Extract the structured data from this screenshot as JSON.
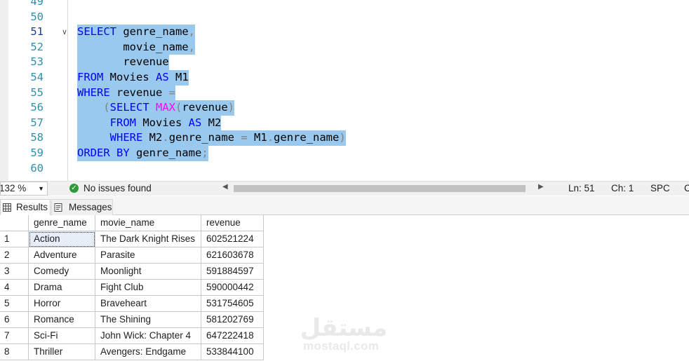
{
  "editor": {
    "lines": [
      {
        "num": "49",
        "tokens": []
      },
      {
        "num": "50",
        "tokens": []
      },
      {
        "num": "51",
        "fold": "∨",
        "tokens": [
          {
            "t": "SELECT",
            "c": "kw"
          },
          {
            "t": " genre_name"
          },
          {
            "t": ",",
            "c": "gray"
          }
        ]
      },
      {
        "num": "52",
        "tokens": [
          {
            "t": "       movie_name"
          },
          {
            "t": ",",
            "c": "gray"
          }
        ]
      },
      {
        "num": "53",
        "tokens": [
          {
            "t": "       revenue"
          }
        ]
      },
      {
        "num": "54",
        "tokens": [
          {
            "t": "FROM",
            "c": "kw"
          },
          {
            "t": " Movies "
          },
          {
            "t": "AS",
            "c": "kw"
          },
          {
            "t": " M1"
          }
        ]
      },
      {
        "num": "55",
        "tokens": [
          {
            "t": "WHERE",
            "c": "kw"
          },
          {
            "t": " revenue "
          },
          {
            "t": "=",
            "c": "gray"
          }
        ]
      },
      {
        "num": "56",
        "tokens": [
          {
            "t": "    "
          },
          {
            "t": "(",
            "c": "gray"
          },
          {
            "t": "SELECT",
            "c": "kw"
          },
          {
            "t": " "
          },
          {
            "t": "MAX",
            "c": "fn"
          },
          {
            "t": "(",
            "c": "gray"
          },
          {
            "t": "revenue"
          },
          {
            "t": ")",
            "c": "gray"
          }
        ]
      },
      {
        "num": "57",
        "tokens": [
          {
            "t": "     "
          },
          {
            "t": "FROM",
            "c": "kw"
          },
          {
            "t": " Movies "
          },
          {
            "t": "AS",
            "c": "kw"
          },
          {
            "t": " M2"
          }
        ]
      },
      {
        "num": "58",
        "tokens": [
          {
            "t": "     "
          },
          {
            "t": "WHERE",
            "c": "kw"
          },
          {
            "t": " M2"
          },
          {
            "t": ".",
            "c": "gray"
          },
          {
            "t": "genre_name "
          },
          {
            "t": "=",
            "c": "gray"
          },
          {
            "t": " M1"
          },
          {
            "t": ".",
            "c": "gray"
          },
          {
            "t": "genre_name"
          },
          {
            "t": ")",
            "c": "gray"
          }
        ]
      },
      {
        "num": "59",
        "tokens": [
          {
            "t": "ORDER BY",
            "c": "kw"
          },
          {
            "t": " genre_name"
          },
          {
            "t": ";",
            "c": "gray"
          }
        ]
      },
      {
        "num": "60",
        "tokens": []
      }
    ],
    "current_line": "51",
    "selected_lines": [
      "51",
      "52",
      "53",
      "54",
      "55",
      "56",
      "57",
      "58",
      "59"
    ]
  },
  "status": {
    "zoom": "132 %",
    "issues": "No issues found",
    "ln": "Ln: 51",
    "ch": "Ch: 1",
    "mode": "SPC",
    "extra": "C"
  },
  "tabs": {
    "results": "Results",
    "messages": "Messages"
  },
  "grid": {
    "headers": [
      "genre_name",
      "movie_name",
      "revenue"
    ],
    "rows": [
      [
        "1",
        "Action",
        "The Dark Knight Rises",
        "602521224"
      ],
      [
        "2",
        "Adventure",
        "Parasite",
        "621603678"
      ],
      [
        "3",
        "Comedy",
        "Moonlight",
        "591884597"
      ],
      [
        "4",
        "Drama",
        "Fight Club",
        "590000442"
      ],
      [
        "5",
        "Horror",
        "Braveheart",
        "531754605"
      ],
      [
        "6",
        "Romance",
        "The Shining",
        "581202769"
      ],
      [
        "7",
        "Sci-Fi",
        "John Wick: Chapter 4",
        "647222418"
      ],
      [
        "8",
        "Thriller",
        "Avengers: Endgame",
        "533844100"
      ]
    ]
  },
  "watermark": {
    "arabic": "مستقل",
    "latin": "mostaql.com"
  },
  "colors": {
    "keyword": "#0000ff",
    "function": "#ff00ff",
    "selection": "#99c9ef",
    "line_number": "#2b91af",
    "success": "#2e9a3c"
  }
}
